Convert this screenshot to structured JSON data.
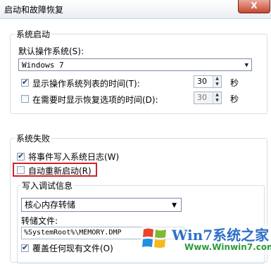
{
  "window": {
    "title": "启动和故障恢复",
    "close_label": "X"
  },
  "startup": {
    "group_title": "系统启动",
    "default_os_label": "默认操作系统(S):",
    "default_os_value": "Windows 7",
    "show_list_label": "显示操作系统列表的时间(T):",
    "show_list_checked": true,
    "show_list_value": "30",
    "show_list_unit": "秒",
    "show_recovery_label": "在需要时显示恢复选项的时间(D):",
    "show_recovery_checked": false,
    "show_recovery_value": "30",
    "show_recovery_unit": "秒"
  },
  "failure": {
    "group_title": "系统失败",
    "write_event_label": "将事件写入系统日志(W)",
    "write_event_checked": true,
    "auto_restart_label": "自动重新启动(R)",
    "auto_restart_checked": false,
    "debug_group_title": "写入调试信息",
    "debug_type_value": "核心内存转储",
    "dump_file_label": "转储文件:",
    "dump_file_value": "%SystemRoot%\\MEMORY.DMP",
    "overwrite_label": "覆盖任何现有文件(O)",
    "overwrite_checked": true
  },
  "watermark": {
    "brand": "Win7系统之家",
    "url": "Www.Winwin7.com"
  },
  "colors": {
    "highlight": "#d3222a",
    "link_blue": "#2e6fc8",
    "brand_green": "#2b9a3a"
  }
}
